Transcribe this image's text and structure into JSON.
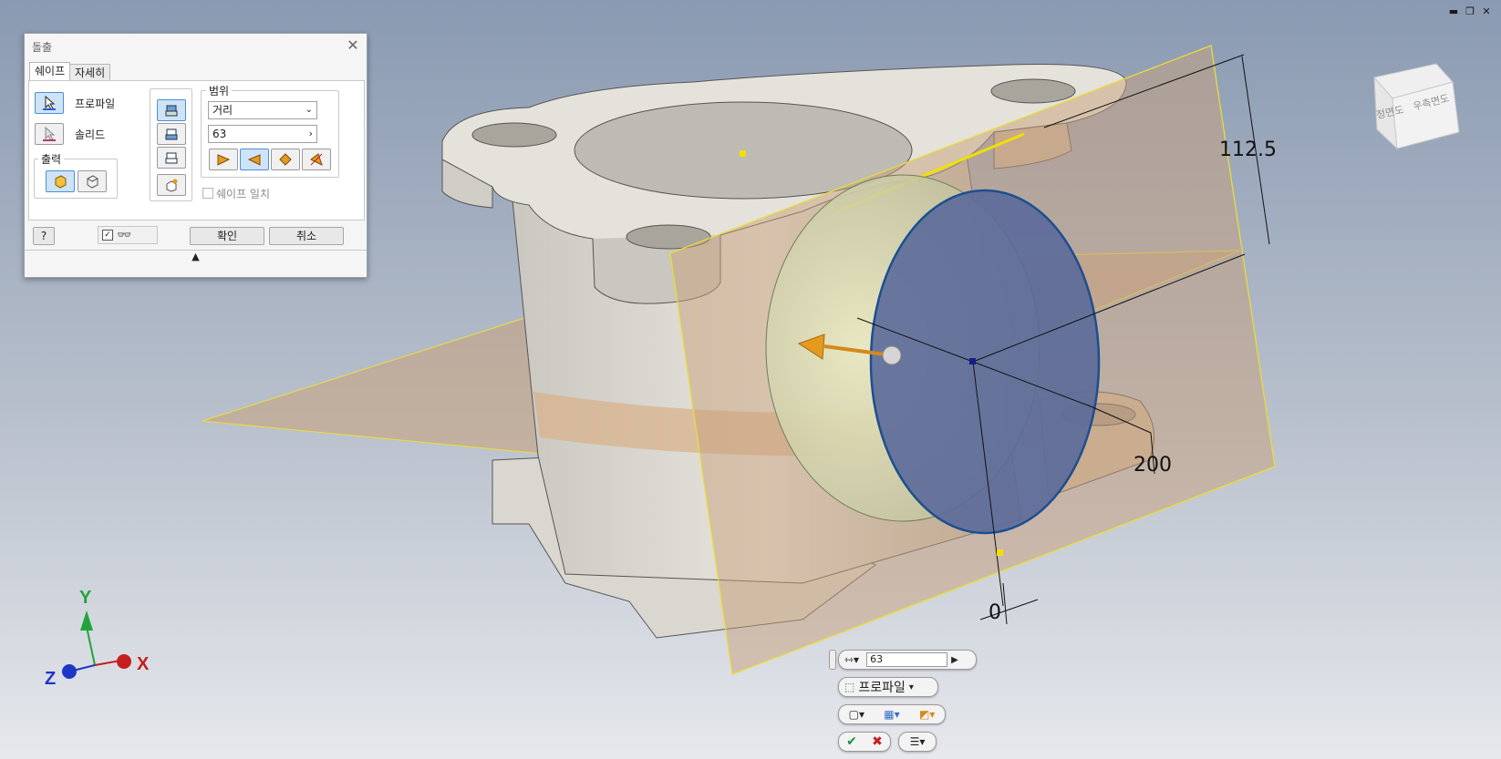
{
  "window": {
    "minimize": "▬",
    "restore": "❐",
    "close": "✕"
  },
  "viewcube": {
    "front": "정면도",
    "right": "우측면도"
  },
  "dimensions": {
    "height": "112.5",
    "width": "200",
    "offset": "0"
  },
  "axes": {
    "x": "X",
    "y": "Y",
    "z": "Z",
    "x_color": "#c41e1e",
    "y_color": "#22a33a",
    "z_color": "#1d37c4"
  },
  "dialog": {
    "title": "돌출",
    "tabs": [
      "쉐이프",
      "자세히"
    ],
    "profile_label": "프로파일",
    "solid_label": "솔리드",
    "output_label": "출력",
    "extent_label": "범위",
    "extent_type": "거리",
    "distance_value": "63",
    "match_shape_label": "쉐이프 일치",
    "ok_label": "확인",
    "cancel_label": "취소",
    "expand_arrow": "▲"
  },
  "minitoolbar": {
    "distance_value": "63",
    "profile_label": "프로파일"
  }
}
